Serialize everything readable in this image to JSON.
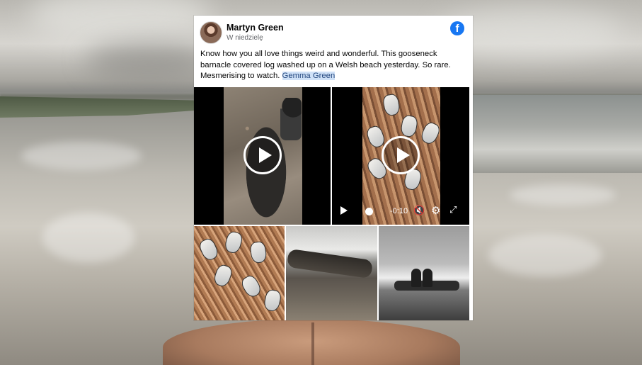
{
  "post": {
    "author": "Martyn Green",
    "timestamp": "W niedzielę",
    "text_before_mention": "Know how you all love things weird and wonderful. This gooseneck barnacle covered log washed up on a Welsh beach yesterday. So rare. Mesmerising to watch. ",
    "mention": "Gemma Green",
    "brand_logo_letter": "f"
  },
  "media": {
    "videos": [
      {
        "label": "video-1",
        "icon": "play-icon"
      },
      {
        "label": "video-2",
        "icon": "play-icon",
        "controls": {
          "time_remaining": "-0:10",
          "play_icon": "play-icon",
          "volume_icon": "volume-muted-icon",
          "settings_icon": "gear-icon",
          "fullscreen_icon": "fullscreen-icon"
        }
      }
    ],
    "photos": [
      "barnacles-closeup",
      "log-on-shore",
      "people-by-log-bw"
    ]
  },
  "colors": {
    "facebook_blue": "#1877f2",
    "mention_bg": "#cfe1f7"
  }
}
